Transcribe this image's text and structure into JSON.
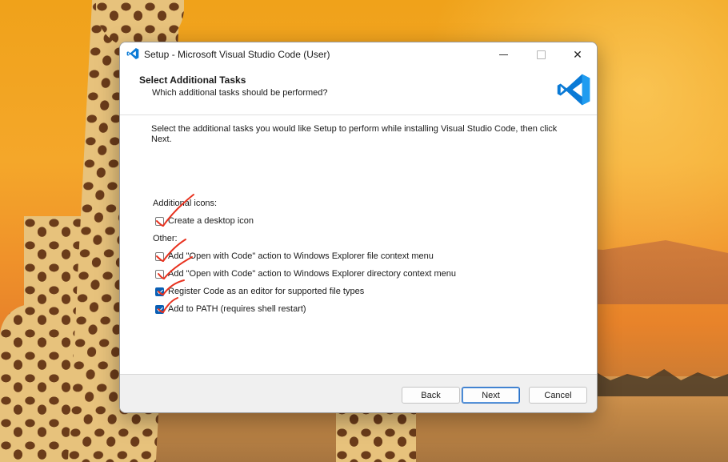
{
  "window": {
    "title": "Setup - Microsoft Visual Studio Code (User)",
    "controls": {
      "minimize_icon": "minimize-icon",
      "maximize_icon": "maximize-icon",
      "close_icon": "close-icon",
      "close_glyph": "✕"
    }
  },
  "header": {
    "title": "Select Additional Tasks",
    "subtitle": "Which additional tasks should be performed?",
    "logo_icon": "vscode-logo-icon"
  },
  "content": {
    "description": "Select the additional tasks you would like Setup to perform while installing Visual Studio Code, then click Next.",
    "groups": [
      {
        "label": "Additional icons:",
        "tasks": [
          {
            "label": "Create a desktop icon",
            "checked": false
          }
        ]
      },
      {
        "label": "Other:",
        "tasks": [
          {
            "label": "Add \"Open with Code\" action to Windows Explorer file context menu",
            "checked": false
          },
          {
            "label": "Add \"Open with Code\" action to Windows Explorer directory context menu",
            "checked": false
          },
          {
            "label": "Register Code as an editor for supported file types",
            "checked": true
          },
          {
            "label": "Add to PATH (requires shell restart)",
            "checked": true
          }
        ]
      }
    ],
    "annotation_color": "#e8321f"
  },
  "footer": {
    "back_label": "Back",
    "next_label": "Next",
    "cancel_label": "Cancel"
  },
  "colors": {
    "accent": "#0a5fb4",
    "vscode_blue": "#0a7ad6"
  }
}
